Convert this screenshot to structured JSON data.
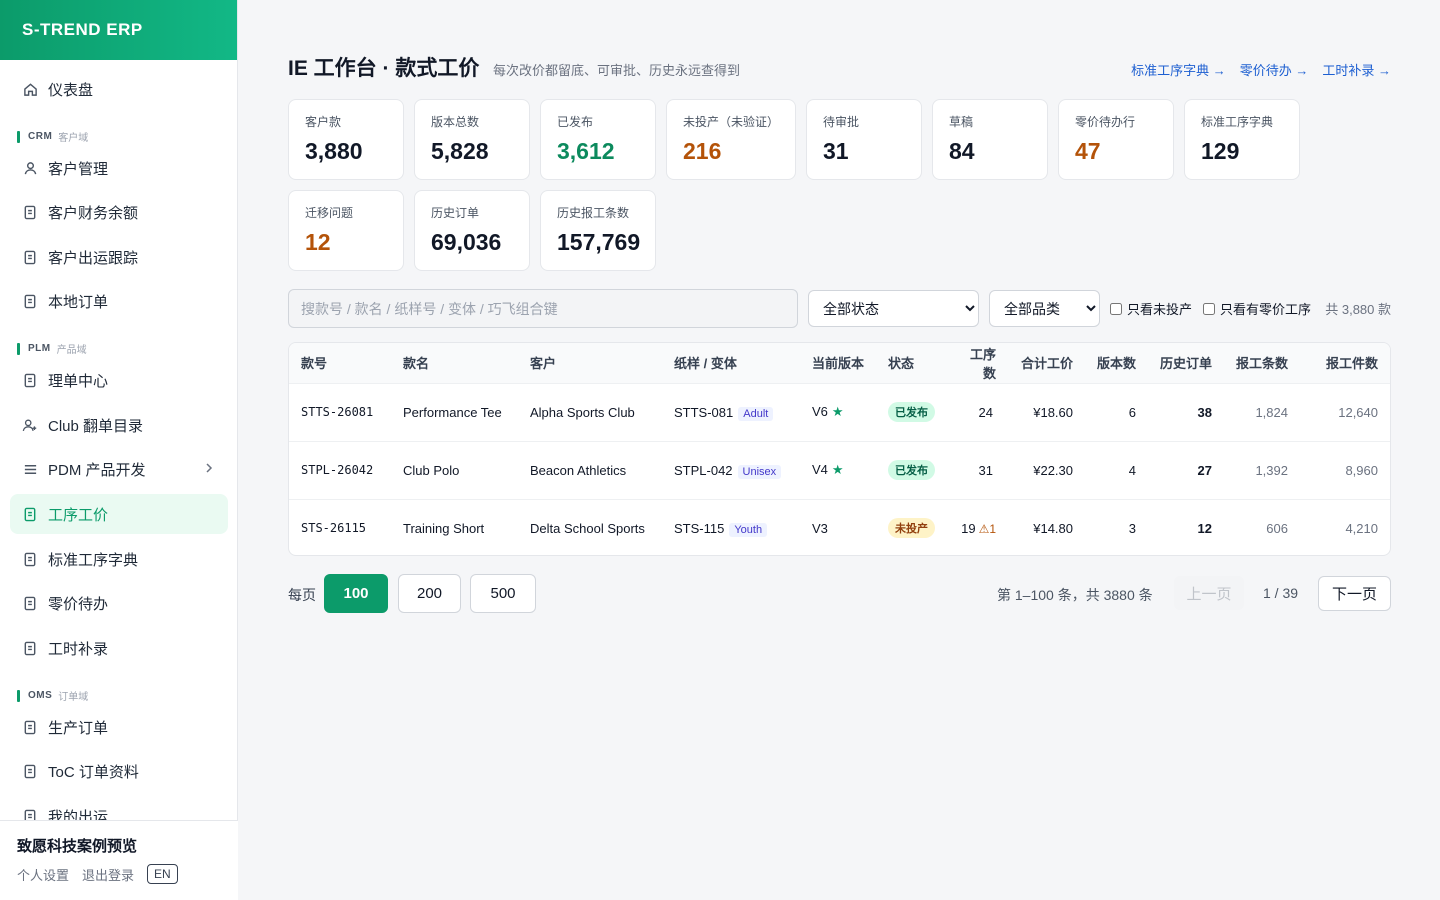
{
  "brand": "S-TREND ERP",
  "sidebar": {
    "items": [
      {
        "label": "仪表盘",
        "icon": "home-icon"
      },
      {
        "label": "客户管理",
        "icon": "user-icon"
      },
      {
        "label": "客户财务余额",
        "icon": "document-icon"
      },
      {
        "label": "客户出运跟踪",
        "icon": "document-icon"
      },
      {
        "label": "本地订单",
        "icon": "document-icon"
      },
      {
        "label": "理单中心",
        "icon": "document-icon"
      },
      {
        "label": "Club 翻单目录",
        "icon": "user-plus-icon"
      },
      {
        "label": "PDM 产品开发",
        "icon": "menu-icon"
      },
      {
        "label": "工序工价",
        "icon": "document-icon"
      },
      {
        "label": "标准工序字典",
        "icon": "document-icon"
      },
      {
        "label": "零价待办",
        "icon": "document-icon"
      },
      {
        "label": "工时补录",
        "icon": "document-icon"
      },
      {
        "label": "生产订单",
        "icon": "document-icon"
      },
      {
        "label": "ToC 订单资料",
        "icon": "document-icon"
      },
      {
        "label": "我的出运",
        "icon": "document-icon"
      }
    ],
    "sections": [
      {
        "code": "CRM",
        "name": "客户域"
      },
      {
        "code": "PLM",
        "name": "产品域"
      },
      {
        "code": "OMS",
        "name": "订单域"
      }
    ],
    "footer": {
      "org": "致愿科技案例预览",
      "settings": "个人设置",
      "logout": "退出登录",
      "lang": "EN"
    }
  },
  "header": {
    "title": "IE 工作台 · 款式工价",
    "subtitle": "每次改价都留底、可审批、历史永远查得到",
    "links": [
      "标准工序字典 →",
      "零价待办 →",
      "工时补录 →"
    ]
  },
  "stats": [
    {
      "label": "客户款",
      "value": "3,880"
    },
    {
      "label": "版本总数",
      "value": "5,828"
    },
    {
      "label": "已发布",
      "value": "3,612"
    },
    {
      "label": "未投产（未验证）",
      "value": "216"
    },
    {
      "label": "待审批",
      "value": "31"
    },
    {
      "label": "草稿",
      "value": "84"
    },
    {
      "label": "零价待办行",
      "value": "47"
    },
    {
      "label": "标准工序字典",
      "value": "129"
    },
    {
      "label": "迁移问题",
      "value": "12"
    },
    {
      "label": "历史订单",
      "value": "69,036"
    },
    {
      "label": "历史报工条数",
      "value": "157,769"
    }
  ],
  "colors": {
    "green": "#0c8a5d",
    "orange": "#b45309",
    "accent": "#0c9b6a",
    "link": "#1d5fd1"
  },
  "filters": {
    "search_placeholder": "搜款号 / 款名 / 纸样号 / 变体 / 巧飞组合键",
    "status": "全部状态",
    "category": "全部品类",
    "only_unproduced": "只看未投产",
    "only_zero_price": "只看有零价工序",
    "count": "共 3,880 款"
  },
  "table": {
    "headers": [
      "款号",
      "款名",
      "客户",
      "纸样 / 变体",
      "当前版本",
      "状态",
      "工序数",
      "合计工价",
      "版本数",
      "历史订单",
      "报工条数",
      "报工件数"
    ],
    "rows": [
      {
        "code": "STTS-26081",
        "name": "Performance Tee",
        "customer": "Alpha Sports Club",
        "pattern": "STTS-081",
        "variant": "Adult",
        "version": "V6",
        "star": "★",
        "status": "已发布",
        "ops": "24",
        "warn": "",
        "price": "¥18.60",
        "versions": "6",
        "orders": "38",
        "reports": "1,824",
        "pieces": "12,640"
      },
      {
        "code": "STPL-26042",
        "name": "Club Polo",
        "customer": "Beacon Athletics",
        "pattern": "STPL-042",
        "variant": "Unisex",
        "version": "V4",
        "star": "★",
        "status": "已发布",
        "ops": "31",
        "warn": "",
        "price": "¥22.30",
        "versions": "4",
        "orders": "27",
        "reports": "1,392",
        "pieces": "8,960"
      },
      {
        "code": "STS-26115",
        "name": "Training Short",
        "customer": "Delta School Sports",
        "pattern": "STS-115",
        "variant": "Youth",
        "version": "V3",
        "star": "",
        "status": "未投产",
        "ops": "19",
        "warn": "⚠1",
        "price": "¥14.80",
        "versions": "3",
        "orders": "12",
        "reports": "606",
        "pieces": "4,210"
      }
    ]
  },
  "pager": {
    "per_page_label": "每页",
    "sizes": [
      "100",
      "200",
      "500"
    ],
    "range": "第 1–100 条，共 3880 条",
    "prev": "上一页",
    "page": "1 / 39",
    "next": "下一页"
  }
}
